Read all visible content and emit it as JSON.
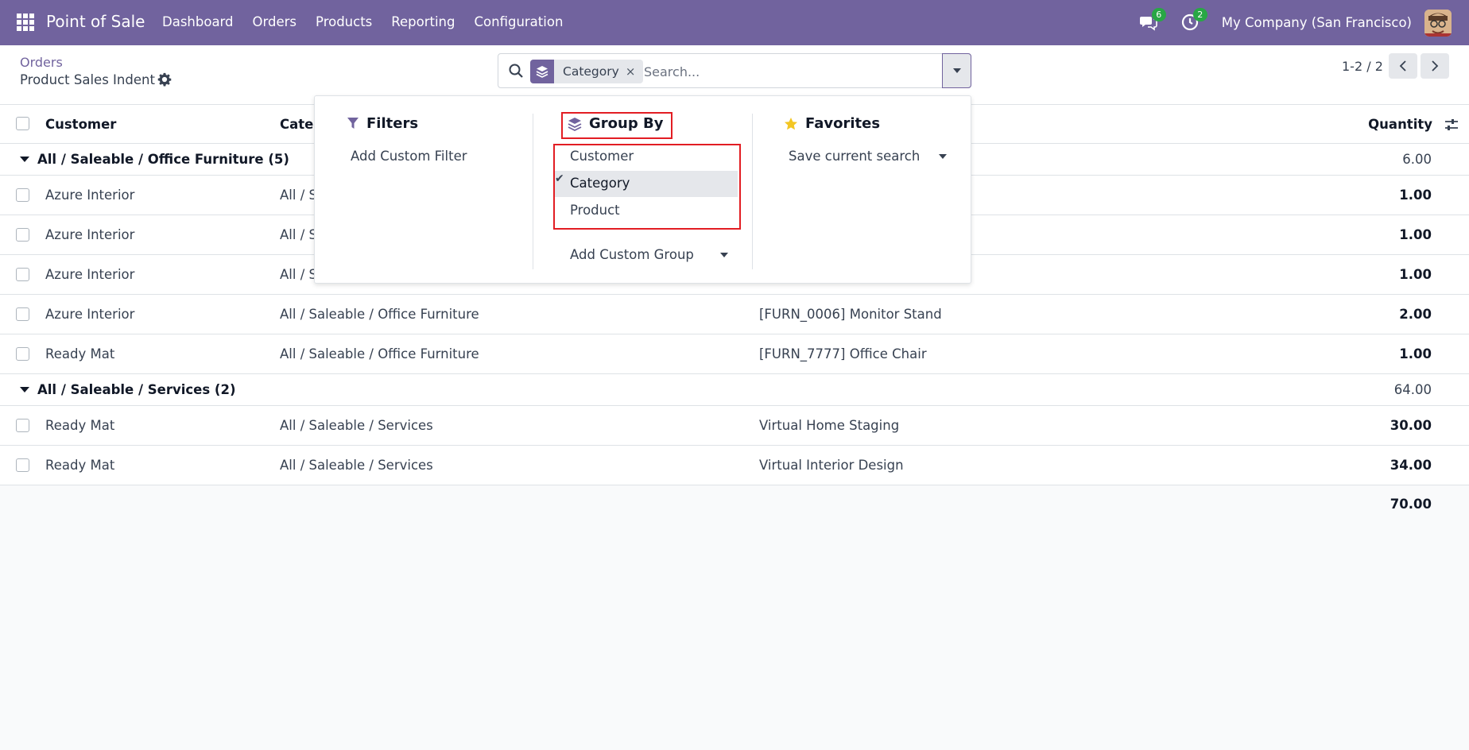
{
  "navbar": {
    "app_name": "Point of Sale",
    "menu": [
      "Dashboard",
      "Orders",
      "Products",
      "Reporting",
      "Configuration"
    ],
    "messages_count": "6",
    "activities_count": "2",
    "company": "My Company (San Francisco)"
  },
  "control_panel": {
    "breadcrumb": "Orders",
    "title": "Product Sales Indent",
    "search": {
      "facet_label": "Category",
      "facet_remove": "×",
      "placeholder": "Search..."
    },
    "pager": "1-2 / 2"
  },
  "table": {
    "columns": [
      "Customer",
      "Categ",
      "Quantity"
    ],
    "groups": [
      {
        "label": "All / Saleable / Office Furniture (5)",
        "total": "6.00",
        "rows": [
          {
            "customer": "Azure Interior",
            "category": "All / S",
            "product": "",
            "quantity": "1.00"
          },
          {
            "customer": "Azure Interior",
            "category": "All / S",
            "product": "",
            "quantity": "1.00"
          },
          {
            "customer": "Azure Interior",
            "category": "All / S",
            "product": "",
            "quantity": "1.00"
          },
          {
            "customer": "Azure Interior",
            "category": "All / Saleable / Office Furniture",
            "product": "[FURN_0006] Monitor Stand",
            "quantity": "2.00"
          },
          {
            "customer": "Ready Mat",
            "category": "All / Saleable / Office Furniture",
            "product": "[FURN_7777] Office Chair",
            "quantity": "1.00"
          }
        ]
      },
      {
        "label": "All / Saleable / Services (2)",
        "total": "64.00",
        "rows": [
          {
            "customer": "Ready Mat",
            "category": "All / Saleable / Services",
            "product": "Virtual Home Staging",
            "quantity": "30.00"
          },
          {
            "customer": "Ready Mat",
            "category": "All / Saleable / Services",
            "product": "Virtual Interior Design",
            "quantity": "34.00"
          }
        ]
      }
    ],
    "grand_total": "70.00"
  },
  "dropdown": {
    "filters": {
      "title": "Filters",
      "items": [
        "Add Custom Filter"
      ]
    },
    "group_by": {
      "title": "Group By",
      "items": [
        "Customer",
        "Category",
        "Product"
      ],
      "selected": "Category",
      "custom": "Add Custom Group"
    },
    "favorites": {
      "title": "Favorites",
      "items": [
        "Save current search"
      ]
    }
  },
  "colors": {
    "brand": "#71639e",
    "highlight": "#e21d23",
    "badge": "#28a745"
  }
}
